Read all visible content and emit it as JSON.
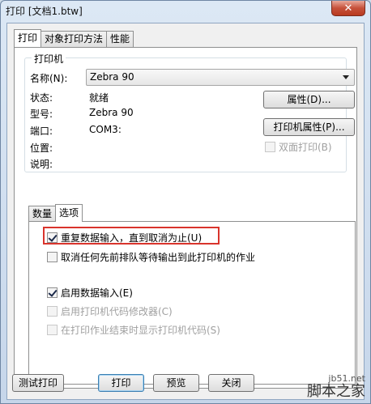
{
  "window": {
    "title": "打印 [文档1.btw]",
    "close_glyph": "✕"
  },
  "top_tabs": [
    "打印",
    "对象打印方法",
    "性能"
  ],
  "printer_group": {
    "title": "打印机",
    "name_label": "名称(N):",
    "selected_printer": "Zebra 90",
    "status_label": "状态:",
    "status_value": "就绪",
    "model_label": "型号:",
    "model_value": "Zebra 90",
    "port_label": "端口:",
    "port_value": "COM3:",
    "location_label": "位置:",
    "comment_label": "说明:",
    "properties_button": "属性(D)...",
    "printer_properties_button": "打印机属性(P)...",
    "duplex_label": "双面打印(B)"
  },
  "inner_tabs": [
    "数量",
    "选项"
  ],
  "options": {
    "repeat_input": "重复数据输入，直到取消为止(U)",
    "cancel_queue": "取消任何先前排队等待输出到此打印机的作业",
    "enable_data_input": "启用数据输入(E)",
    "enable_code_modifier": "启用打印机代码修改器(C)",
    "show_code": "在打印作业结束时显示打印机代码(S)"
  },
  "buttons": {
    "test_print": "测试打印",
    "print": "打印",
    "preview": "预览",
    "close": "关闭"
  },
  "watermark": {
    "line1": "jb51.net",
    "line2": "脚本之家"
  }
}
